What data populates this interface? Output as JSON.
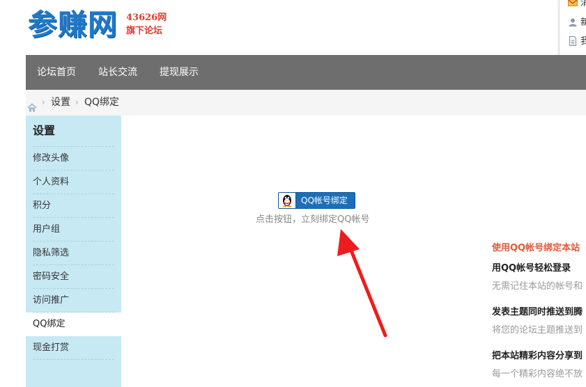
{
  "header": {
    "logo_main": "参赚网",
    "logo_sub_1": "43626网",
    "logo_sub_2": "旗下论坛"
  },
  "top_menu": {
    "items": [
      {
        "label": "消息",
        "icon": "mail-icon"
      },
      {
        "label": "新",
        "icon": "user-icon"
      },
      {
        "label": "我",
        "icon": "document-icon"
      }
    ]
  },
  "nav": {
    "items": [
      "论坛首页",
      "站长交流",
      "提现展示"
    ]
  },
  "breadcrumb": {
    "home_icon": "home-icon",
    "items": [
      "设置",
      "QQ绑定"
    ]
  },
  "sidebar": {
    "title": "设置",
    "items": [
      "修改头像",
      "个人资料",
      "积分",
      "用户组",
      "隐私筛选",
      "密码安全",
      "访问推广",
      "QQ绑定",
      "现金打赏"
    ],
    "active": "QQ绑定"
  },
  "main": {
    "qq_button_label": "QQ帐号绑定",
    "hint": "点击按钮，立刻绑定QQ帐号",
    "feature_title": "使用QQ帐号绑定本站",
    "features": [
      {
        "heading": "用QQ帐号轻松登录",
        "desc": "无需记住本站的帐号和"
      },
      {
        "heading": "发表主题同时推送到腾",
        "desc": "将您的论坛主题推送到"
      },
      {
        "heading": "把本站精彩内容分享到",
        "desc": "每一个精彩内容绝不放"
      }
    ]
  },
  "colors": {
    "brand_blue": "#1f78c8",
    "nav_bg": "#6e6e6e",
    "sidebar_bg": "#c7e9f4",
    "accent_red": "#e05a3b",
    "button_blue": "#1b6fb8"
  }
}
